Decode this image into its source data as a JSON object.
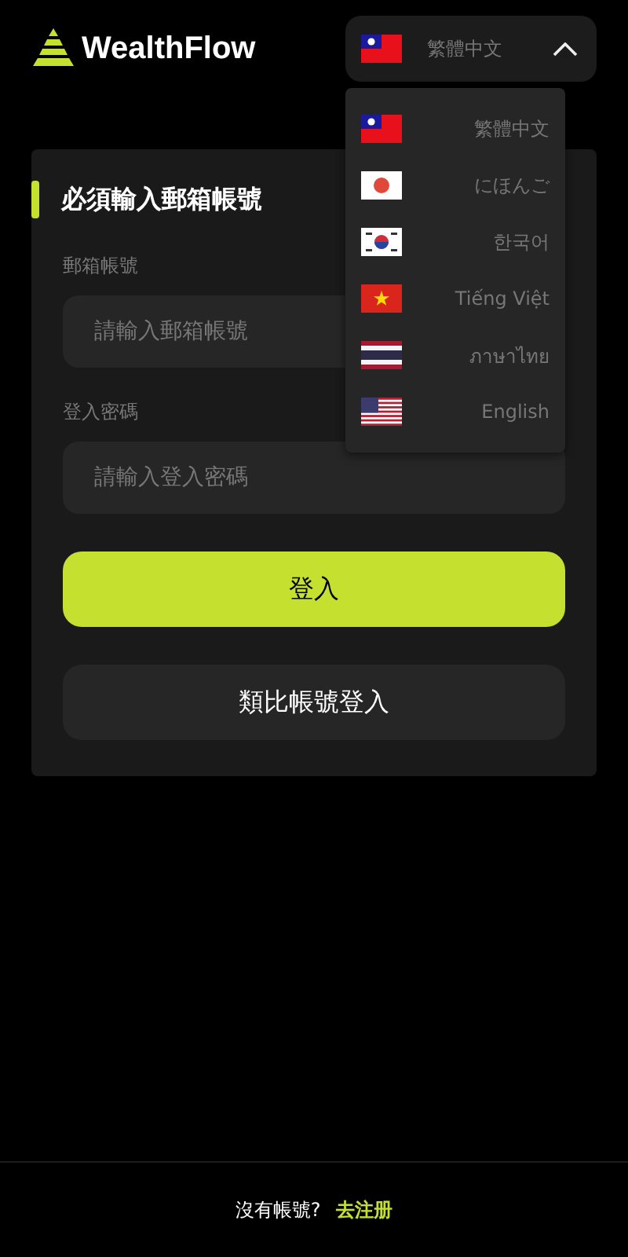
{
  "header": {
    "logo_text": "WealthFlow",
    "language_switcher": {
      "kind": "tw",
      "label": "繁體中文",
      "expanded": true
    }
  },
  "language_menu": [
    {
      "kind": "tw",
      "label": "繁體中文"
    },
    {
      "kind": "jp",
      "label": "にほんご"
    },
    {
      "kind": "kr",
      "label": "한국어"
    },
    {
      "kind": "vn",
      "label": "Tiếng Việt"
    },
    {
      "kind": "th",
      "label": "ภาษาไทย"
    },
    {
      "kind": "us",
      "label": "English"
    }
  ],
  "login_card": {
    "title": "必須輸入郵箱帳號",
    "email": {
      "label": "郵箱帳號",
      "placeholder": "請輸入郵箱帳號"
    },
    "password": {
      "label": "登入密碼",
      "placeholder": "請輸入登入密碼"
    },
    "login_button": "登入",
    "demo_button": "類比帳號登入"
  },
  "footer": {
    "prompt": "沒有帳號?",
    "link": "去注册"
  }
}
